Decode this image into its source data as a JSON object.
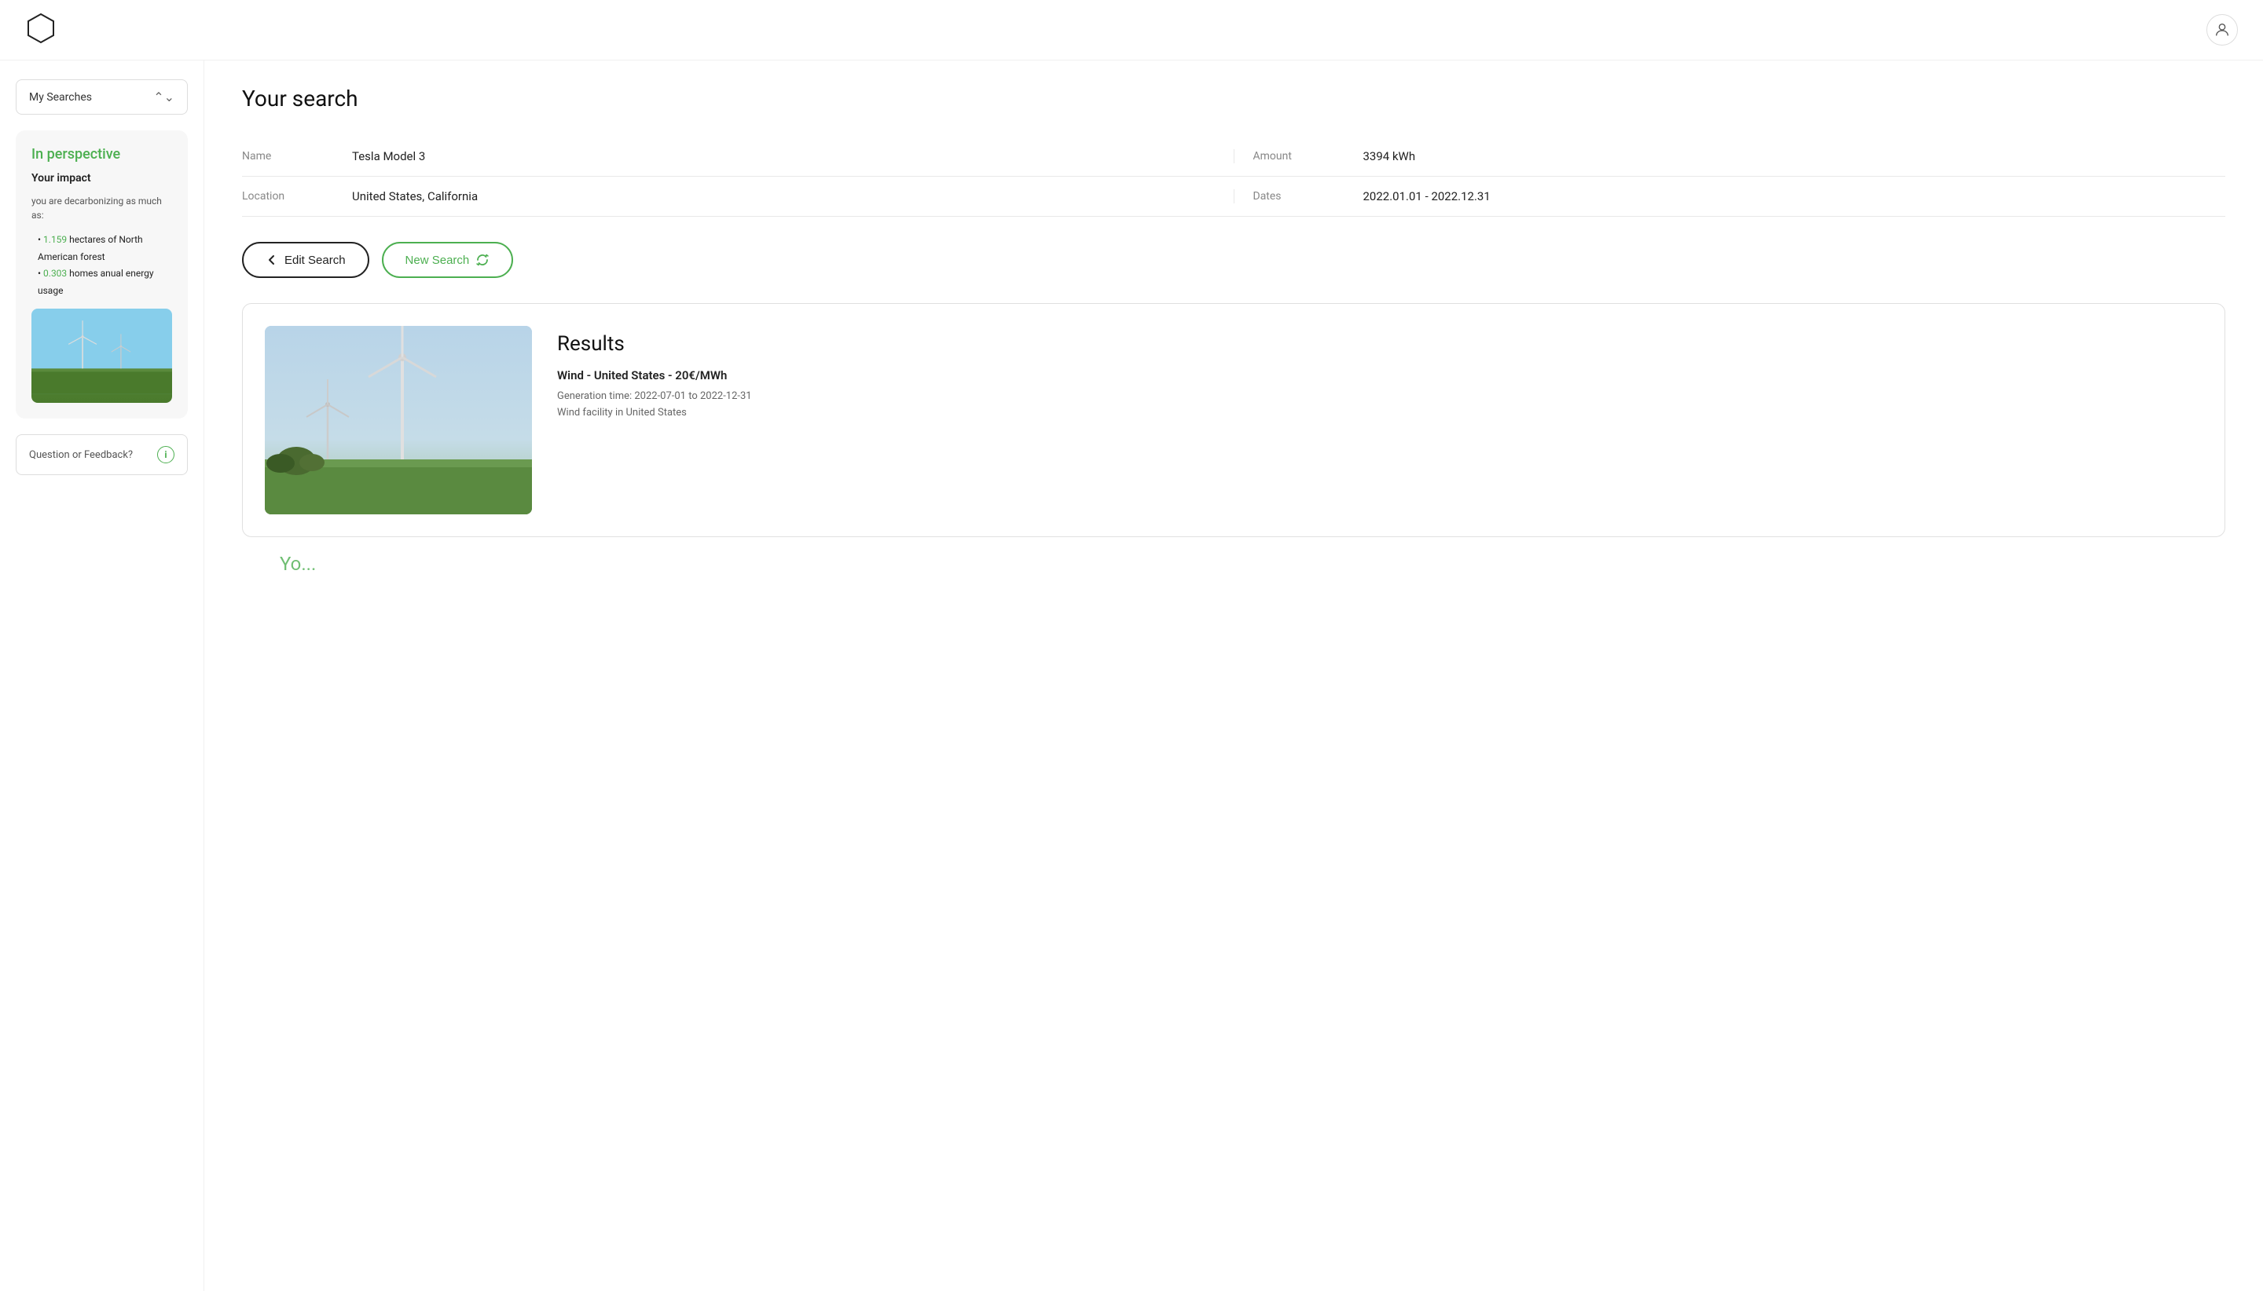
{
  "header": {
    "logo_alt": "App Logo"
  },
  "sidebar": {
    "my_searches_label": "My Searches",
    "perspective": {
      "title": "In perspective",
      "your_impact": "Your impact",
      "description": "you are decarbonizing as much as:",
      "items": [
        {
          "value": "1.159",
          "text": " hectares of North American forest"
        },
        {
          "value": "0.303",
          "text": " homes anual energy usage"
        }
      ]
    },
    "feedback_label": "Question or Feedback?"
  },
  "main": {
    "page_title": "Your search",
    "search": {
      "name_label": "Name",
      "name_value": "Tesla Model 3",
      "amount_label": "Amount",
      "amount_value": "3394 kWh",
      "location_label": "Location",
      "location_value": "United States, California",
      "dates_label": "Dates",
      "dates_value": "2022.01.01 - 2022.12.31"
    },
    "buttons": {
      "edit_label": "Edit Search",
      "new_label": "New Search"
    },
    "results": {
      "title": "Results",
      "result_name": "Wind - United States - 20€/MWh",
      "generation_time": "Generation time: 2022-07-01 to 2022-12-31",
      "facility": "Wind facility in United States"
    },
    "bottom_peek": "Yo..."
  }
}
